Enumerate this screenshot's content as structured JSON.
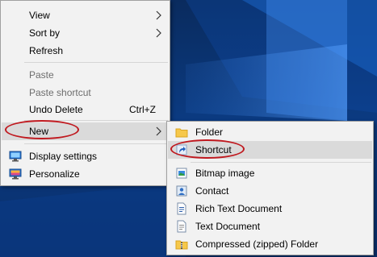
{
  "context_menu": {
    "items": [
      {
        "label": "View"
      },
      {
        "label": "Sort by"
      },
      {
        "label": "Refresh"
      },
      {
        "label": "Paste"
      },
      {
        "label": "Paste shortcut"
      },
      {
        "label": "Undo Delete",
        "shortcut": "Ctrl+Z"
      },
      {
        "label": "New"
      },
      {
        "label": "Display settings"
      },
      {
        "label": "Personalize"
      }
    ]
  },
  "new_submenu": {
    "items": [
      {
        "label": "Folder"
      },
      {
        "label": "Shortcut"
      },
      {
        "label": "Bitmap image"
      },
      {
        "label": "Contact"
      },
      {
        "label": "Rich Text Document"
      },
      {
        "label": "Text Document"
      },
      {
        "label": "Compressed (zipped) Folder"
      }
    ]
  },
  "colors": {
    "annotation_oval": "#c0191f",
    "highlight": "#dadada",
    "desktop_blue": "#0b3a80"
  }
}
